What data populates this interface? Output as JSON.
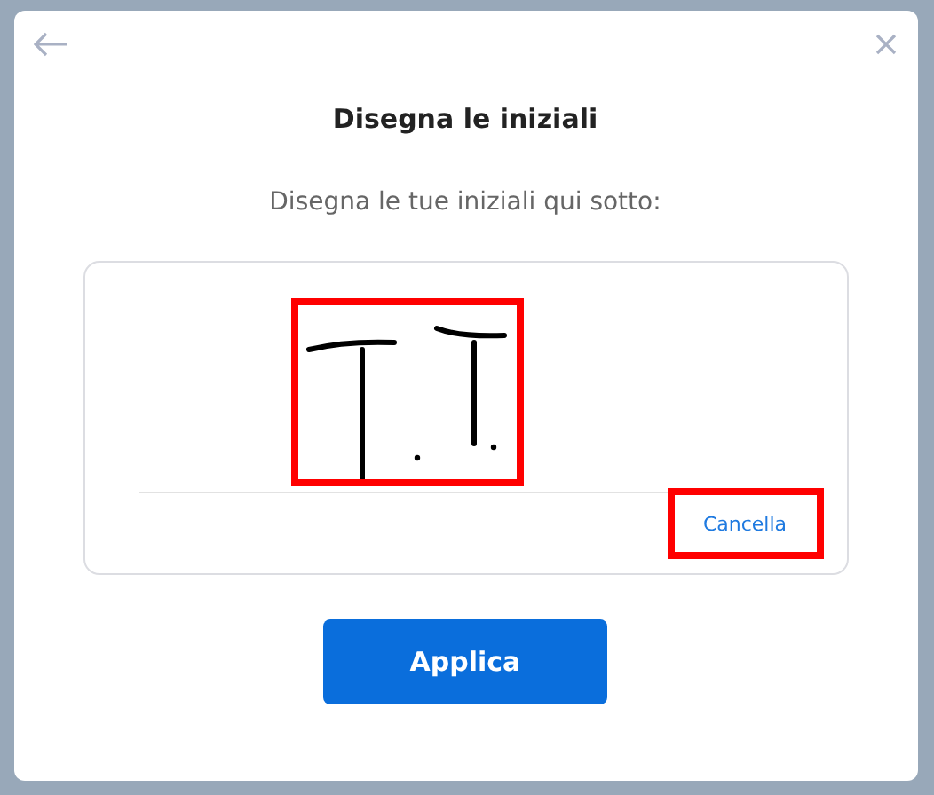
{
  "dialog": {
    "title": "Disegna le iniziali",
    "instruction": "Disegna le tue iniziali qui sotto:"
  },
  "signature_pad": {
    "drawing_highlighted": true,
    "clear_label": "Cancella",
    "clear_highlighted": true
  },
  "buttons": [
    {
      "label": "Applica",
      "kind": "primary"
    }
  ]
}
